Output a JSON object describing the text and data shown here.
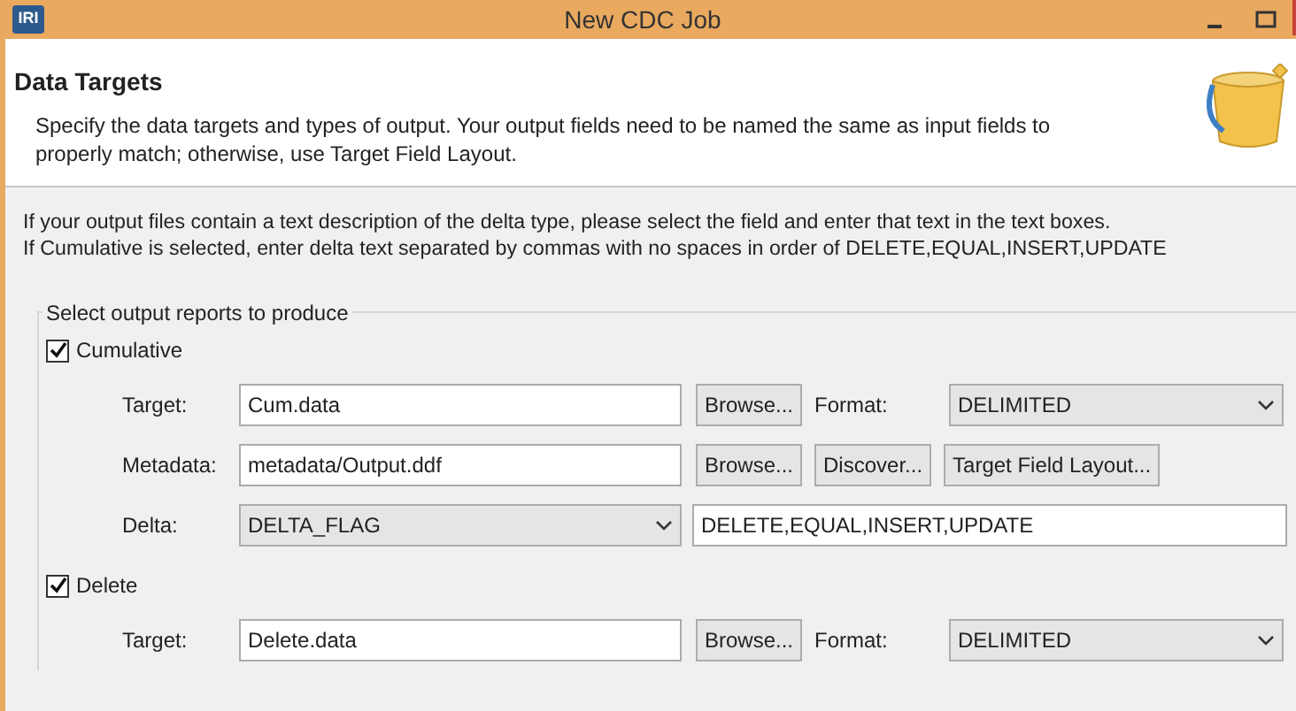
{
  "window": {
    "logo": "IRI",
    "title": "New CDC Job"
  },
  "header": {
    "title": "Data Targets",
    "description": "Specify the data targets and types of output. Your output fields need to be named the same as input fields to properly match; otherwise, use Target Field Layout."
  },
  "info_lines": [
    "If your output files contain a text description of the delta type, please select the field and enter that text in the text boxes.",
    "If Cumulative is selected, enter delta text separated by commas with no spaces in order of DELETE,EQUAL,INSERT,UPDATE"
  ],
  "group": {
    "title": "Select output reports to produce",
    "sections": [
      {
        "label": "Cumulative",
        "checked": true,
        "rows": [
          [
            {
              "kind": "label",
              "text": "Target:"
            },
            {
              "kind": "input",
              "text": "Cum.data"
            },
            {
              "kind": "button",
              "text": "Browse..."
            },
            {
              "kind": "label",
              "text": "Format:"
            },
            {
              "kind": "select",
              "text": "DELIMITED"
            }
          ],
          [
            {
              "kind": "label",
              "text": "Metadata:"
            },
            {
              "kind": "input",
              "text": "metadata/Output.ddf"
            },
            {
              "kind": "button",
              "text": "Browse..."
            },
            {
              "kind": "button",
              "text": "Discover..."
            },
            {
              "kind": "button",
              "text": "Target Field Layout..."
            }
          ],
          [
            {
              "kind": "label",
              "text": "Delta:"
            },
            {
              "kind": "select",
              "text": "DELTA_FLAG"
            },
            {
              "kind": "input",
              "text": "DELETE,EQUAL,INSERT,UPDATE"
            }
          ]
        ]
      },
      {
        "label": "Delete",
        "checked": true,
        "rows": [
          [
            {
              "kind": "label",
              "text": "Target:"
            },
            {
              "kind": "input",
              "text": "Delete.data"
            },
            {
              "kind": "button",
              "text": "Browse..."
            },
            {
              "kind": "label",
              "text": "Format:"
            },
            {
              "kind": "select",
              "text": "DELIMITED"
            }
          ]
        ]
      }
    ]
  }
}
